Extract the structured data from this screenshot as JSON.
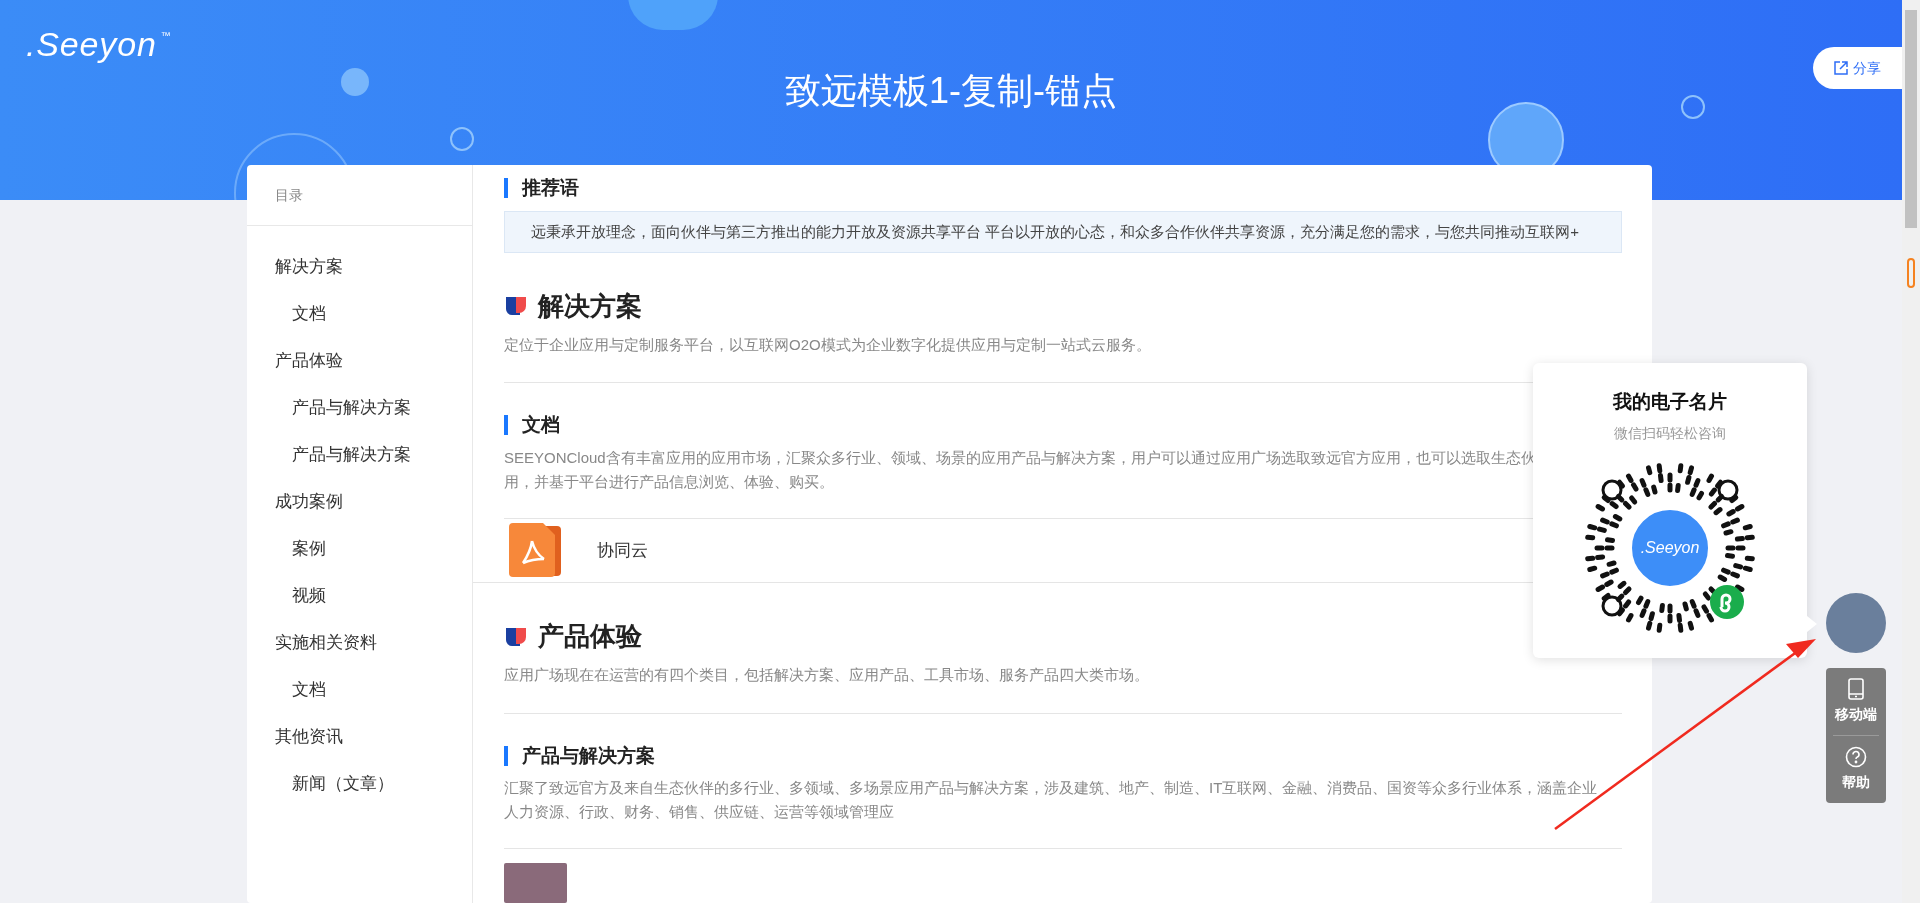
{
  "header": {
    "logo": ".Seeyon",
    "logo_mark": "™",
    "title": "致远模板1-复制-锚点",
    "share": "分享"
  },
  "sidebar": {
    "title": "目录",
    "items": [
      {
        "label": "解决方案",
        "children": [
          {
            "label": "文档"
          }
        ]
      },
      {
        "label": "产品体验",
        "children": [
          {
            "label": "产品与解决方案"
          },
          {
            "label": "产品与解决方案"
          }
        ]
      },
      {
        "label": "成功案例",
        "children": [
          {
            "label": "案例"
          },
          {
            "label": "视频"
          }
        ]
      },
      {
        "label": "实施相关资料",
        "children": [
          {
            "label": "文档"
          }
        ]
      },
      {
        "label": "其他资讯",
        "children": [
          {
            "label": "新闻（文章）"
          }
        ]
      }
    ]
  },
  "content": [
    {
      "kind": "subheading",
      "title": "推荐语"
    },
    {
      "kind": "quote",
      "text": "远秉承开放理念，面向伙伴与第三方推出的能力开放及资源共享平台 平台以开放的心态，和众多合作伙伴共享资源，充分满足您的需求，与您共同推动互联网+"
    },
    {
      "kind": "section",
      "title": "解决方案",
      "text": "定位于企业应用与定制服务平台，以互联网O2O模式为企业数字化提供应用与定制一站式云服务。"
    },
    {
      "kind": "subsection",
      "title": "文档",
      "lines": [
        "SEEYONCloud含有丰富应用的应用市场，汇聚众多行业、领域、场景的应用产品与解决方案，用户可以通过应用广场选取致远官方应用，也可以选取生态伙",
        "用，并基于平台进行产品信息浏览、体验、购买。"
      ]
    },
    {
      "kind": "file",
      "title": "协同云"
    },
    {
      "kind": "section",
      "title": "产品体验",
      "text": "应用广场现在在运营的有四个类目，包括解决方案、应用产品、工具市场、服务产品四大类市场。"
    },
    {
      "kind": "subsection",
      "title": "产品与解决方案",
      "lines": [
        "汇聚了致远官方及来自生态伙伴的多行业、多领域、多场景应用产品与解决方案，涉及建筑、地产、制造、IT互联网、金融、消费品、国资等众多行业体系，涵盖企业人力资源、行政、财务、销售、供应链、运营等领域管理应"
      ]
    },
    {
      "kind": "photo"
    }
  ],
  "card": {
    "title": "我的电子名片",
    "subtitle": "微信扫码轻松咨询",
    "qr_logo": ".Seeyon"
  },
  "tools": [
    {
      "kind": "mobile",
      "label": "移动端"
    },
    {
      "kind": "help",
      "label": "帮助"
    }
  ]
}
